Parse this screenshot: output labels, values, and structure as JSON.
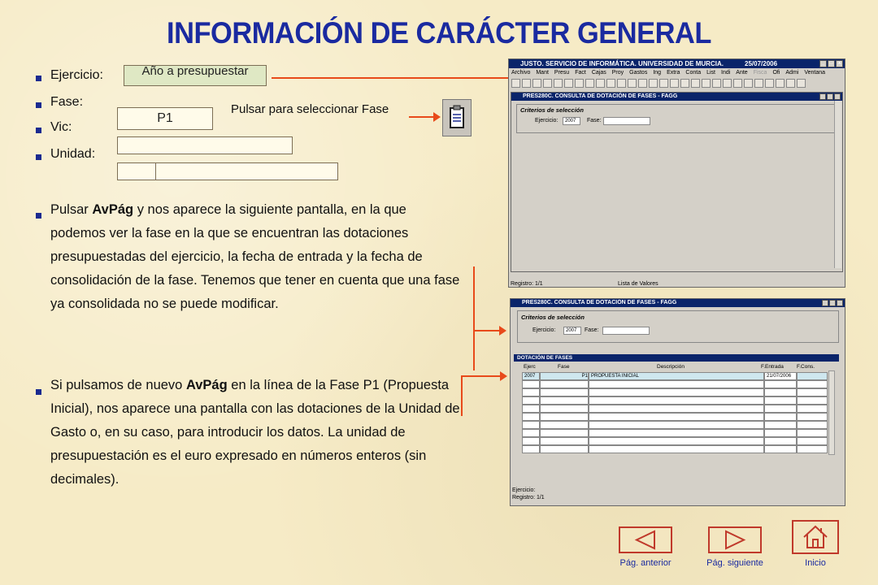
{
  "title": "INFORMACIÓN DE CARÁCTER GENERAL",
  "fields": {
    "ejercicio_label": "Ejercicio:",
    "ejercicio_value": "Año a presupuestar",
    "fase_label": "Fase:",
    "fase_value": "P1",
    "fase_hint": "Pulsar para seleccionar Fase",
    "vic_label": "Vic:",
    "unidad_label": "Unidad:"
  },
  "para1": {
    "t1": "Pulsar ",
    "b1": "AvPág",
    "t2": " y nos aparece la siguiente pantalla, en la que podemos ver la fase en la que se encuentran las dotaciones presupuestadas del ejercicio, la fecha de entrada y la fecha de consolidación de la fase. Tenemos que tener en cuenta que una fase ya consolidada no se puede modificar."
  },
  "para2": {
    "t1": " Si pulsamos de nuevo ",
    "b1": "AvPág",
    "t2": " en la línea de la Fase P1 (Propuesta Inicial), nos aparece una pantalla con las dotaciones de la Unidad de Gasto o, en su caso, para introducir los datos. La unidad de presupuestación es el euro expresado en números enteros (sin decimales)."
  },
  "screen1": {
    "app_title": "JUSTO. SERVICIO DE INFORMÁTICA. UNIVERSIDAD DE MURCIA.",
    "app_date": "25/07/2006",
    "menu": [
      "Archivo",
      "Mant",
      "Presu",
      "Fact",
      "Cajas",
      "Proy",
      "Gastos",
      "Ing",
      "Extra",
      "Conta",
      "List",
      "Indi",
      "Ante",
      "Fisca",
      "Ofi",
      "Admi",
      "Ventana"
    ],
    "form_title": "PRES280C. CONSULTA DE DOTACIÓN DE FASES - FAGG",
    "criteria_title": "Criterios de selección",
    "ejercicio_label": "Ejercicio:",
    "ejercicio_value": "2007",
    "fase_label": "Fase:",
    "status_left": "Registro: 1/1",
    "status_right": "Lista de Valores"
  },
  "screen2": {
    "form_title": "PRES280C. CONSULTA DE DOTACIÓN DE FASES - FAGG",
    "criteria_title": "Criterios de selección",
    "ejercicio_label": "Ejercicio:",
    "ejercicio_value": "2007",
    "fase_label": "Fase:",
    "block_title": "DOTACIÓN DE FASES",
    "columns": [
      "Ejerc",
      "Fase",
      "Descripción",
      "F.Entrada",
      "F.Cons."
    ],
    "row1": {
      "ejerc": "2007",
      "fase": "P1",
      "desc": "PROPUESTA INICIAL",
      "fentrada": "21/07/2006",
      "fcons": ""
    },
    "status_1": "Ejercicio:",
    "status_2": "Registro: 1/1"
  },
  "nav": {
    "prev": "Pág. anterior",
    "next": "Pág. siguiente",
    "home": "Inicio"
  },
  "colors": {
    "title": "#1a2aa0",
    "arrow": "#e84a1a",
    "titlebar": "#0a246a"
  }
}
